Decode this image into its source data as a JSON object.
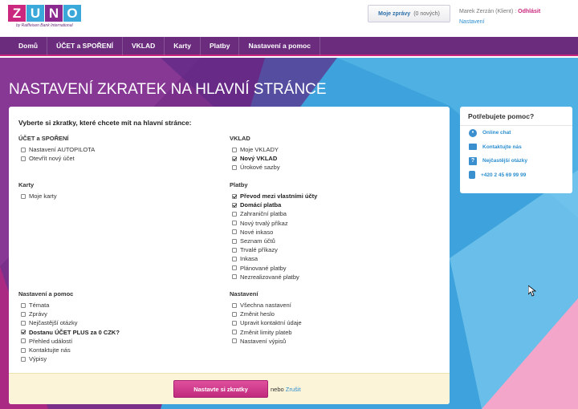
{
  "header": {
    "logo_letters": [
      "Z",
      "U",
      "N",
      "O"
    ],
    "logo_subtitle": "by Raiffeisen Bank International",
    "messages_label": "Moje zprávy",
    "messages_count": "(0 nových)",
    "user_name": "Marek Zerzán (Klient) :",
    "logout_label": "Odhlásit",
    "settings_label": "Nastavení"
  },
  "nav": {
    "items": [
      "Domů",
      "ÚČET a SPOŘENÍ",
      "VKLAD",
      "Karty",
      "Platby",
      "Nastavení a pomoc"
    ]
  },
  "page_title": "NASTAVENÍ ZKRATEK NA HLAVNÍ STRÁNCE",
  "form": {
    "intro": "Vyberte si zkratky, které chcete mít na hlavní stránce:",
    "groups": {
      "ucet": {
        "title": "ÚČET a SPOŘENÍ",
        "options": [
          {
            "label": "Nastavení AUTOPILOTA",
            "checked": false
          },
          {
            "label": "Otevřít nový účet",
            "checked": false
          }
        ]
      },
      "vklad": {
        "title": "VKLAD",
        "options": [
          {
            "label": "Moje VKLADY",
            "checked": false
          },
          {
            "label": "Nový VKLAD",
            "checked": true
          },
          {
            "label": "Úrokové sazby",
            "checked": false
          }
        ]
      },
      "karty": {
        "title": "Karty",
        "options": [
          {
            "label": "Moje karty",
            "checked": false
          }
        ]
      },
      "platby": {
        "title": "Platby",
        "options": [
          {
            "label": "Převod mezi vlastními účty",
            "checked": true
          },
          {
            "label": "Domácí platba",
            "checked": true
          },
          {
            "label": "Zahraniční platba",
            "checked": false
          },
          {
            "label": "Nový trvalý příkaz",
            "checked": false
          },
          {
            "label": "Nové inkaso",
            "checked": false
          },
          {
            "label": "Seznam účtů",
            "checked": false
          },
          {
            "label": "Trvalé příkazy",
            "checked": false
          },
          {
            "label": "Inkasa",
            "checked": false
          },
          {
            "label": "Plánované platby",
            "checked": false
          },
          {
            "label": "Nezrealizované platby",
            "checked": false
          }
        ]
      },
      "pomoc": {
        "title": "Nastavení a pomoc",
        "options": [
          {
            "label": "Témata",
            "checked": false
          },
          {
            "label": "Zprávy",
            "checked": false
          },
          {
            "label": "Nejčastější otázky",
            "checked": false
          },
          {
            "label": "Dostanu ÚČET PLUS za 0 CZK?",
            "checked": true
          },
          {
            "label": "Přehled událostí",
            "checked": false
          },
          {
            "label": "Kontaktujte nás",
            "checked": false
          },
          {
            "label": "Výpisy",
            "checked": false
          }
        ]
      },
      "nastaveni": {
        "title": "Nastavení",
        "options": [
          {
            "label": "Všechna nastavení",
            "checked": false
          },
          {
            "label": "Změnit heslo",
            "checked": false
          },
          {
            "label": "Upravit kontaktní údaje",
            "checked": false
          },
          {
            "label": "Změnit limity plateb",
            "checked": false
          },
          {
            "label": "Nastavení výpisů",
            "checked": false
          }
        ]
      }
    },
    "submit_label": "Nastavte si zkratky",
    "or_label": "nebo",
    "cancel_label": "Zrušit"
  },
  "help": {
    "title": "Potřebujete pomoc?",
    "items": [
      {
        "icon": "chat-icon",
        "label": "Online chat"
      },
      {
        "icon": "mail-icon",
        "label": "Kontaktujte nás"
      },
      {
        "icon": "question-icon",
        "label": "Nejčastější otázky"
      },
      {
        "icon": "phone-icon",
        "label": "+420 2 45 69 99 99"
      }
    ]
  },
  "colors": {
    "brand_purple": "#6b2c7e",
    "brand_pink": "#c9287e",
    "brand_blue": "#3aa8d8",
    "link_blue": "#2b8ed0"
  }
}
